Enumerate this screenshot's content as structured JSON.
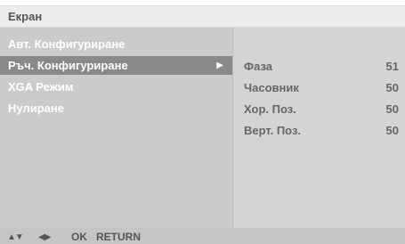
{
  "header": {
    "title": "Екран"
  },
  "menu": {
    "items": [
      {
        "label": "Авт. Конфигуриране",
        "selected": false
      },
      {
        "label": "Ръч. Конфигуриране",
        "selected": true
      },
      {
        "label": "XGA Режим",
        "selected": false
      },
      {
        "label": "Нулиране",
        "selected": false
      }
    ],
    "submenu_arrow_icon": "triangle-right-icon"
  },
  "submenu": {
    "items": [
      {
        "label": "Фаза",
        "value": "51"
      },
      {
        "label": "Часовник",
        "value": "50"
      },
      {
        "label": "Хор. Поз.",
        "value": "50"
      },
      {
        "label": "Верт. Поз.",
        "value": "50"
      }
    ]
  },
  "footer": {
    "up_down_icon": "▲▼",
    "left_right_icon": "◀▶",
    "ok_label": "OK",
    "return_label": "RETURN"
  },
  "colors": {
    "title_bar": "#ececec",
    "left_panel": "#cbcbcb",
    "right_panel": "#d4d4d4",
    "selected_item": "#898989",
    "bottom_bar": "#c5c5c5"
  }
}
